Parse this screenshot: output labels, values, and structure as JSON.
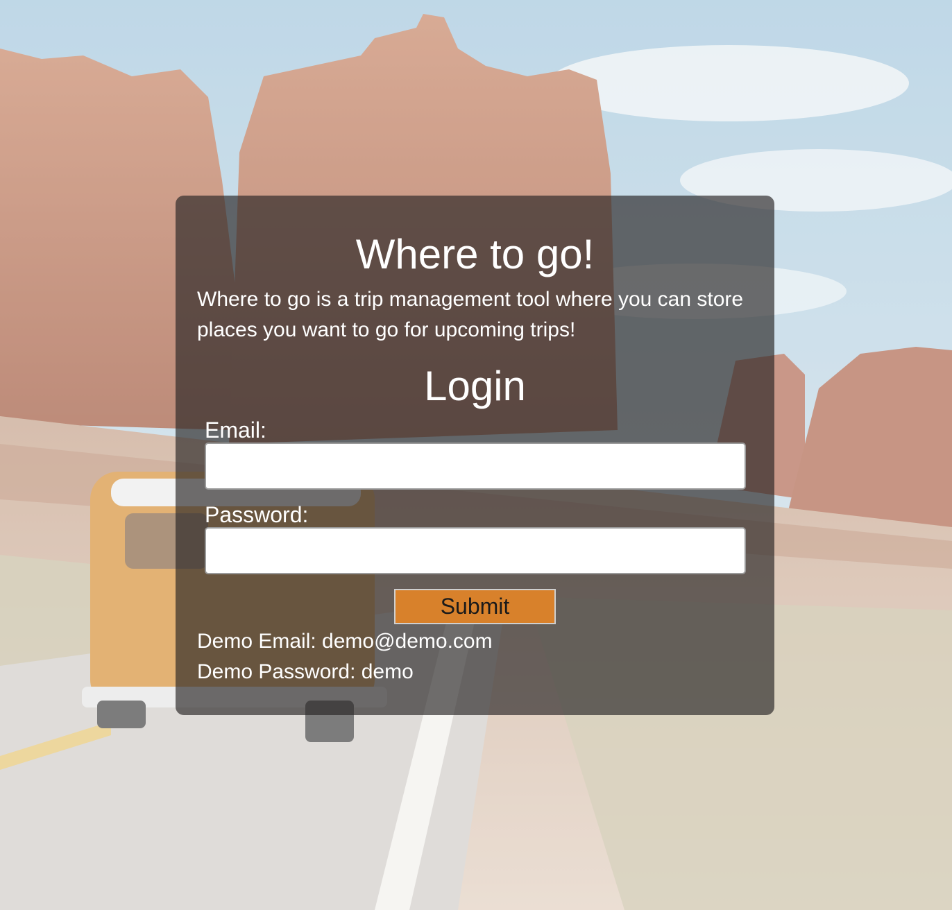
{
  "app": {
    "title": "Where to go!",
    "description": "Where to go is a trip management tool where you can store places you want to go for upcoming trips!"
  },
  "login": {
    "heading": "Login",
    "email_label": "Email:",
    "email_value": "",
    "password_label": "Password:",
    "password_value": "",
    "submit_label": "Submit"
  },
  "demo": {
    "email_text": "Demo Email: demo@demo.com",
    "password_text": "Demo Password: demo"
  },
  "colors": {
    "card_overlay": "#282424",
    "submit_button": "#d8812b",
    "text": "#ffffff"
  }
}
